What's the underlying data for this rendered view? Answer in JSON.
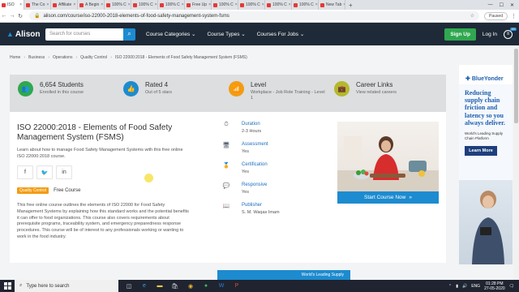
{
  "browser": {
    "tabs": [
      {
        "label": "ISO"
      },
      {
        "label": "The Co"
      },
      {
        "label": "Affiliate"
      },
      {
        "label": "A Begin"
      },
      {
        "label": "100% C"
      },
      {
        "label": "100% C"
      },
      {
        "label": "100% C"
      },
      {
        "label": "Free Up"
      },
      {
        "label": "100% C"
      },
      {
        "label": "100% C"
      },
      {
        "label": "100% C"
      },
      {
        "label": "100% C"
      },
      {
        "label": "New Tab"
      }
    ],
    "new_tab": "+",
    "url": "alison.com/course/iso-22000-2018-elements-of-food-safety-management-system-fsms",
    "paused_label": "Paused"
  },
  "header": {
    "logo": "Alison",
    "search_placeholder": "Search for courses",
    "nav": [
      "Course Categories",
      "Course Types",
      "Courses For Jobs"
    ],
    "signup": "Sign Up",
    "login": "Log In",
    "badge": "101"
  },
  "breadcrumb": [
    "Home",
    "Business",
    "Operations",
    "Quality Control",
    "ISO 22000:2018 - Elements of Food Safety Management System (FSMS)"
  ],
  "stats": [
    {
      "title": "6,654 Students",
      "sub": "Enrolled in this course",
      "color": "#2fa84f",
      "icon": "students-icon",
      "glyph": "👥"
    },
    {
      "title": "Rated 4",
      "sub": "Out of 5 stars",
      "color": "#1d8bcf",
      "icon": "thumbs-up-icon",
      "glyph": "👍"
    },
    {
      "title": "Level",
      "sub": "Workplace - Job Role Training - Level 1",
      "color": "#f39c12",
      "icon": "level-icon",
      "glyph": "📶"
    },
    {
      "title": "Career Links",
      "sub": "View related careers",
      "color": "#b5b82c",
      "icon": "briefcase-icon",
      "glyph": "💼"
    }
  ],
  "course": {
    "title": "ISO 22000:2018 - Elements of Food Safety Management System (FSMS)",
    "description": "Learn about how to manage Food Safety Management Systems with this free online ISO 22000:2018 course.",
    "category_tag": "Quality Control",
    "price_tag": "Free Course",
    "long_description": "This free online course outlines the elements of ISO 22000 for Food Safety Management Systems by explaining how this standard works and the potential benefits it can offer to food organizations. This course also covers requirements about prerequisite programs, traceability system, and emergency preparedness response procedures. This course will be of interest to any professionals working or wanting to work in the food industry.",
    "start_button": "Start Course Now"
  },
  "meta": [
    {
      "label": "Duration",
      "value": "2-3 Hours",
      "icon": "clock-icon",
      "glyph": "⏱"
    },
    {
      "label": "Assessment",
      "value": "Yes",
      "icon": "assessment-icon",
      "glyph": "🖥"
    },
    {
      "label": "Certification",
      "value": "Yes",
      "icon": "certificate-icon",
      "glyph": "🏅"
    },
    {
      "label": "Responsive",
      "value": "Yes",
      "icon": "responsive-icon",
      "glyph": "💬"
    },
    {
      "label": "Publisher",
      "value": "S. M. Waqas Imam",
      "icon": "publisher-icon",
      "glyph": "📖"
    }
  ],
  "ad": {
    "brand": "BlueYonder",
    "headline": "Reducing supply chain friction and latency so you always deliver.",
    "sub": "World's Leading Supply Chain Platform",
    "button": "Learn More"
  },
  "bottom_banner": "World's Leading Supply",
  "taskbar": {
    "search_placeholder": "Type here to search",
    "lang": "ENG",
    "time": "01:28 PM",
    "date": "27-05-2020"
  }
}
